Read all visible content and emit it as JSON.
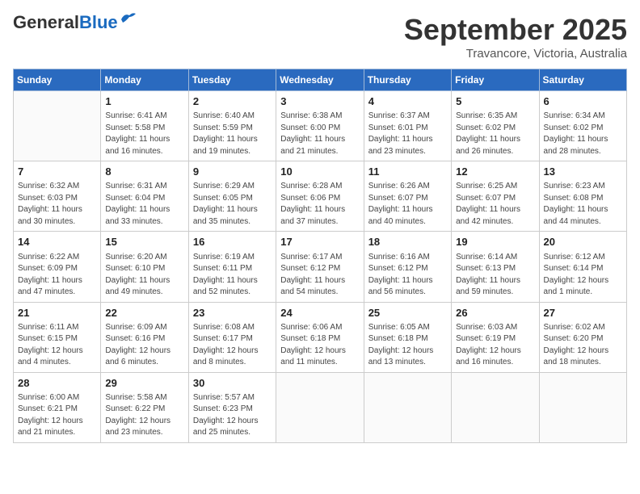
{
  "header": {
    "logo_line1": "General",
    "logo_line2": "Blue",
    "month": "September 2025",
    "location": "Travancore, Victoria, Australia"
  },
  "days_of_week": [
    "Sunday",
    "Monday",
    "Tuesday",
    "Wednesday",
    "Thursday",
    "Friday",
    "Saturday"
  ],
  "weeks": [
    [
      {
        "day": "",
        "info": ""
      },
      {
        "day": "1",
        "info": "Sunrise: 6:41 AM\nSunset: 5:58 PM\nDaylight: 11 hours\nand 16 minutes."
      },
      {
        "day": "2",
        "info": "Sunrise: 6:40 AM\nSunset: 5:59 PM\nDaylight: 11 hours\nand 19 minutes."
      },
      {
        "day": "3",
        "info": "Sunrise: 6:38 AM\nSunset: 6:00 PM\nDaylight: 11 hours\nand 21 minutes."
      },
      {
        "day": "4",
        "info": "Sunrise: 6:37 AM\nSunset: 6:01 PM\nDaylight: 11 hours\nand 23 minutes."
      },
      {
        "day": "5",
        "info": "Sunrise: 6:35 AM\nSunset: 6:02 PM\nDaylight: 11 hours\nand 26 minutes."
      },
      {
        "day": "6",
        "info": "Sunrise: 6:34 AM\nSunset: 6:02 PM\nDaylight: 11 hours\nand 28 minutes."
      }
    ],
    [
      {
        "day": "7",
        "info": "Sunrise: 6:32 AM\nSunset: 6:03 PM\nDaylight: 11 hours\nand 30 minutes."
      },
      {
        "day": "8",
        "info": "Sunrise: 6:31 AM\nSunset: 6:04 PM\nDaylight: 11 hours\nand 33 minutes."
      },
      {
        "day": "9",
        "info": "Sunrise: 6:29 AM\nSunset: 6:05 PM\nDaylight: 11 hours\nand 35 minutes."
      },
      {
        "day": "10",
        "info": "Sunrise: 6:28 AM\nSunset: 6:06 PM\nDaylight: 11 hours\nand 37 minutes."
      },
      {
        "day": "11",
        "info": "Sunrise: 6:26 AM\nSunset: 6:07 PM\nDaylight: 11 hours\nand 40 minutes."
      },
      {
        "day": "12",
        "info": "Sunrise: 6:25 AM\nSunset: 6:07 PM\nDaylight: 11 hours\nand 42 minutes."
      },
      {
        "day": "13",
        "info": "Sunrise: 6:23 AM\nSunset: 6:08 PM\nDaylight: 11 hours\nand 44 minutes."
      }
    ],
    [
      {
        "day": "14",
        "info": "Sunrise: 6:22 AM\nSunset: 6:09 PM\nDaylight: 11 hours\nand 47 minutes."
      },
      {
        "day": "15",
        "info": "Sunrise: 6:20 AM\nSunset: 6:10 PM\nDaylight: 11 hours\nand 49 minutes."
      },
      {
        "day": "16",
        "info": "Sunrise: 6:19 AM\nSunset: 6:11 PM\nDaylight: 11 hours\nand 52 minutes."
      },
      {
        "day": "17",
        "info": "Sunrise: 6:17 AM\nSunset: 6:12 PM\nDaylight: 11 hours\nand 54 minutes."
      },
      {
        "day": "18",
        "info": "Sunrise: 6:16 AM\nSunset: 6:12 PM\nDaylight: 11 hours\nand 56 minutes."
      },
      {
        "day": "19",
        "info": "Sunrise: 6:14 AM\nSunset: 6:13 PM\nDaylight: 11 hours\nand 59 minutes."
      },
      {
        "day": "20",
        "info": "Sunrise: 6:12 AM\nSunset: 6:14 PM\nDaylight: 12 hours\nand 1 minute."
      }
    ],
    [
      {
        "day": "21",
        "info": "Sunrise: 6:11 AM\nSunset: 6:15 PM\nDaylight: 12 hours\nand 4 minutes."
      },
      {
        "day": "22",
        "info": "Sunrise: 6:09 AM\nSunset: 6:16 PM\nDaylight: 12 hours\nand 6 minutes."
      },
      {
        "day": "23",
        "info": "Sunrise: 6:08 AM\nSunset: 6:17 PM\nDaylight: 12 hours\nand 8 minutes."
      },
      {
        "day": "24",
        "info": "Sunrise: 6:06 AM\nSunset: 6:18 PM\nDaylight: 12 hours\nand 11 minutes."
      },
      {
        "day": "25",
        "info": "Sunrise: 6:05 AM\nSunset: 6:18 PM\nDaylight: 12 hours\nand 13 minutes."
      },
      {
        "day": "26",
        "info": "Sunrise: 6:03 AM\nSunset: 6:19 PM\nDaylight: 12 hours\nand 16 minutes."
      },
      {
        "day": "27",
        "info": "Sunrise: 6:02 AM\nSunset: 6:20 PM\nDaylight: 12 hours\nand 18 minutes."
      }
    ],
    [
      {
        "day": "28",
        "info": "Sunrise: 6:00 AM\nSunset: 6:21 PM\nDaylight: 12 hours\nand 21 minutes."
      },
      {
        "day": "29",
        "info": "Sunrise: 5:58 AM\nSunset: 6:22 PM\nDaylight: 12 hours\nand 23 minutes."
      },
      {
        "day": "30",
        "info": "Sunrise: 5:57 AM\nSunset: 6:23 PM\nDaylight: 12 hours\nand 25 minutes."
      },
      {
        "day": "",
        "info": ""
      },
      {
        "day": "",
        "info": ""
      },
      {
        "day": "",
        "info": ""
      },
      {
        "day": "",
        "info": ""
      }
    ]
  ]
}
